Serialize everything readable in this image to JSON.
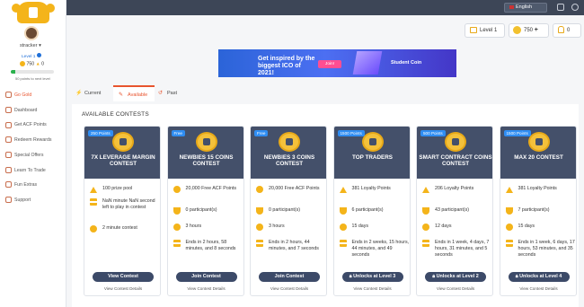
{
  "topbar": {
    "language": "English"
  },
  "header": {
    "level_label": "Level 1",
    "coins": "750",
    "notifications": "0"
  },
  "user": {
    "name": "stracker",
    "level": "Level 1",
    "coins": "750",
    "warn": "0",
    "progress": 0.1,
    "next_level_text": "50 points to next level"
  },
  "sidebar": {
    "items": [
      {
        "label": "Go Gold",
        "icon": "medal-icon",
        "active": true
      },
      {
        "label": "Dashboard",
        "icon": "dashboard-icon"
      },
      {
        "label": "Get ACF Points",
        "icon": "gift-icon"
      },
      {
        "label": "Redeem Rewards",
        "icon": "redeem-icon"
      },
      {
        "label": "Special Offers",
        "icon": "tag-icon"
      },
      {
        "label": "Learn To Trade",
        "icon": "book-icon"
      },
      {
        "label": "Fun Extras",
        "icon": "gamepad-icon"
      },
      {
        "label": "Support",
        "icon": "lifebuoy-icon"
      }
    ]
  },
  "banner": {
    "text": "Get inspired by the biggest ICO of 2021!",
    "join": "Join!",
    "brand": "Student Coin"
  },
  "tabs": [
    {
      "label": "Current"
    },
    {
      "label": "Available"
    },
    {
      "label": "Past"
    }
  ],
  "section_title": "AVAILABLE CONTESTS",
  "contests": [
    {
      "badge": "250 Points",
      "title": "7X LEVERAGE MARGIN CONTEST",
      "rows": [
        {
          "icon": "warning",
          "text": "100 prize pool"
        },
        {
          "icon": "hourglass",
          "text": "NaN minute NaN second left to play in contest"
        },
        {
          "icon": "clock",
          "text": "2 minute contest"
        }
      ],
      "button": "View Contest",
      "details": "View Contest Details"
    },
    {
      "badge": "Free",
      "title": "NEWBIES 15 COINS CONTEST",
      "rows": [
        {
          "icon": "coin",
          "text": "20,000 Free ACF Points"
        },
        {
          "icon": "trophy",
          "text": "0 participant(s)"
        },
        {
          "icon": "clock",
          "text": "3 hours"
        },
        {
          "icon": "hourglass",
          "text": "Ends in 2 hours, 58 minutes, and 8 seconds"
        }
      ],
      "button": "Join Contest",
      "details": "View Contest Details"
    },
    {
      "badge": "Free",
      "title": "NEWBIES 3 COINS CONTEST",
      "rows": [
        {
          "icon": "coin",
          "text": "20,000 Free ACF Points"
        },
        {
          "icon": "trophy",
          "text": "0 participant(s)"
        },
        {
          "icon": "clock",
          "text": "3 hours"
        },
        {
          "icon": "hourglass",
          "text": "Ends in 2 hours, 44 minutes, and 7 seconds"
        }
      ],
      "button": "Join Contest",
      "details": "View Contest Details"
    },
    {
      "badge": "1500 Points",
      "title": "TOP TRADERS",
      "rows": [
        {
          "icon": "warning",
          "text": "381 Loyalty Points"
        },
        {
          "icon": "trophy",
          "text": "6 participant(s)"
        },
        {
          "icon": "clock",
          "text": "15 days"
        },
        {
          "icon": "hourglass",
          "text": "Ends in 2 weeks, 15 hours, 44 minutes, and 49 seconds"
        }
      ],
      "button": "Unlocks at Level 3",
      "details": "View Contest Details"
    },
    {
      "badge": "500 Points",
      "title": "SMART CONTRACT COINS CONTEST",
      "rows": [
        {
          "icon": "warning",
          "text": "206 Loyalty Points"
        },
        {
          "icon": "trophy",
          "text": "43 participant(s)"
        },
        {
          "icon": "clock",
          "text": "12 days"
        },
        {
          "icon": "hourglass",
          "text": "Ends in 1 week, 4 days, 7 hours, 31 minutes, and 5 seconds"
        }
      ],
      "button": "Unlocks at Level 2",
      "details": "View Contest Details"
    },
    {
      "badge": "1500 Points",
      "title": "MAX 20 CONTEST",
      "rows": [
        {
          "icon": "warning",
          "text": "381 Loyalty Points"
        },
        {
          "icon": "trophy",
          "text": "7 participant(s)"
        },
        {
          "icon": "clock",
          "text": "15 days"
        },
        {
          "icon": "hourglass",
          "text": "Ends in 1 week, 6 days, 17 hours, 53 minutes, and 35 seconds"
        }
      ],
      "button": "Unlocks at Level 4",
      "details": "View Contest Details"
    }
  ]
}
